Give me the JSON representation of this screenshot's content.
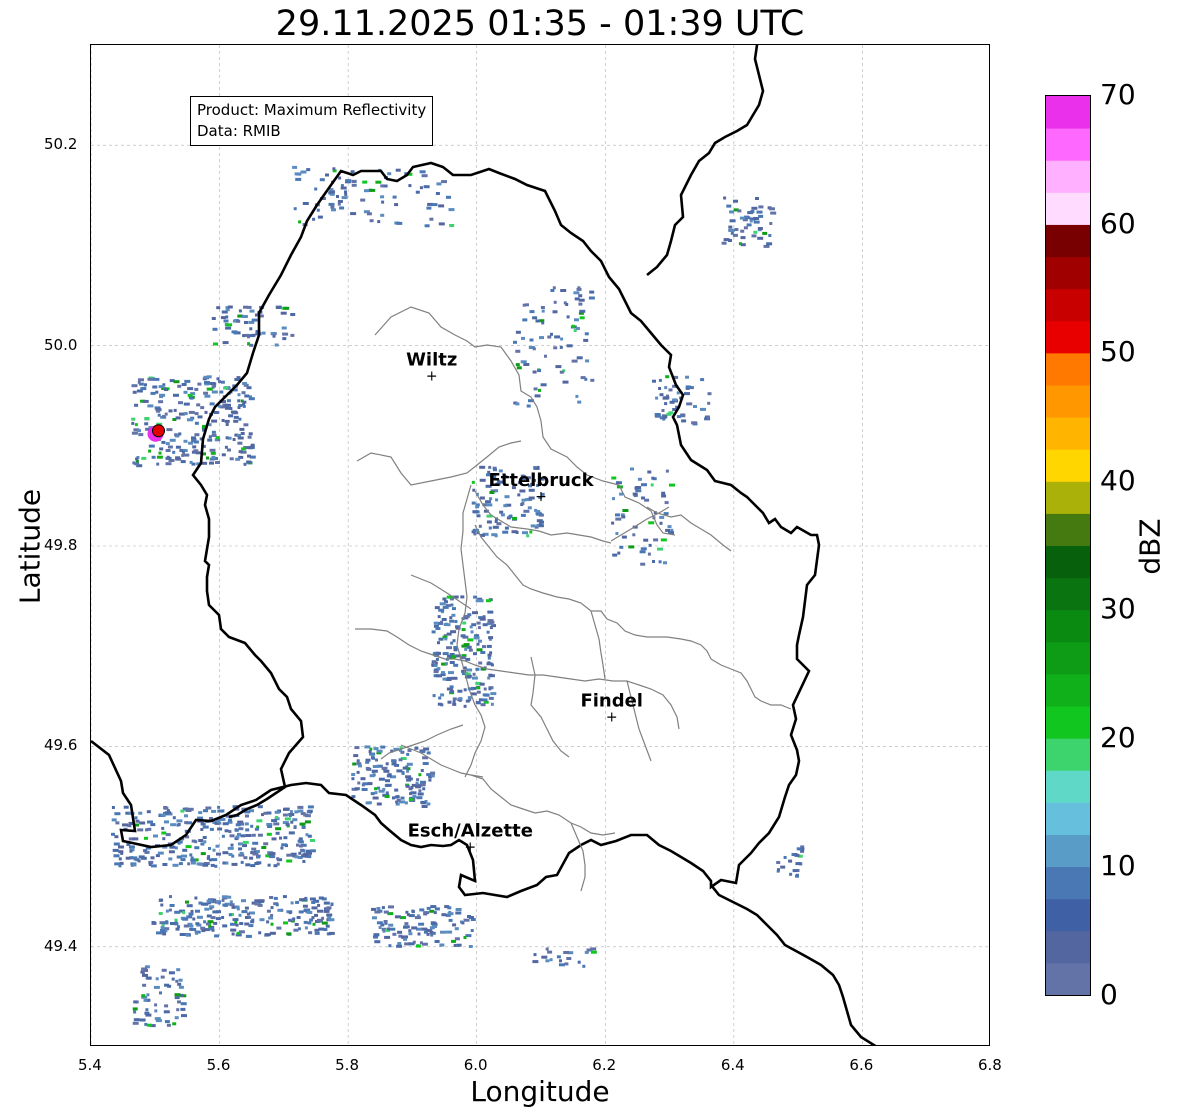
{
  "title": "29.11.2025 01:35 - 01:39 UTC",
  "info": {
    "product": "Product: Maximum Reflectivity",
    "data_source": "Data: RMIB"
  },
  "axes": {
    "xlabel": "Longitude",
    "ylabel": "Latitude",
    "xlim": [
      5.4,
      6.8
    ],
    "ylim": [
      49.3,
      50.3
    ],
    "xticks": [
      "5.4",
      "5.6",
      "5.8",
      "6.0",
      "6.2",
      "6.4",
      "6.6",
      "6.8"
    ],
    "yticks": [
      "49.4",
      "49.6",
      "49.8",
      "50.0",
      "50.2"
    ],
    "grid": true
  },
  "cities": [
    {
      "name": "Wiltz",
      "lon": 5.93,
      "lat": 49.97
    },
    {
      "name": "Ettelbruck",
      "lon": 6.1,
      "lat": 49.85
    },
    {
      "name": "Findel",
      "lon": 6.21,
      "lat": 49.63
    },
    {
      "name": "Esch/Alzette",
      "lon": 5.99,
      "lat": 49.5
    }
  ],
  "radar_site": {
    "lon": 5.505,
    "lat": 49.915
  },
  "colorbar": {
    "label": "dBZ",
    "min": 0,
    "max": 70,
    "tick_labels": [
      "0",
      "10",
      "20",
      "30",
      "40",
      "50",
      "60",
      "70"
    ],
    "colors": [
      "#6373a8",
      "#5466a0",
      "#4060a5",
      "#4a78b5",
      "#5a9cc8",
      "#66c0dd",
      "#60d8c8",
      "#3dd46e",
      "#12c620",
      "#10b01a",
      "#0e9c16",
      "#0b8a12",
      "#097410",
      "#06600c",
      "#457a10",
      "#aab20a",
      "#ffd600",
      "#ffb400",
      "#ff9800",
      "#ff7800",
      "#e80000",
      "#c80000",
      "#a00000",
      "#780000",
      "#ffdcff",
      "#ffb0ff",
      "#ff68ff",
      "#ea30ea"
    ]
  }
}
